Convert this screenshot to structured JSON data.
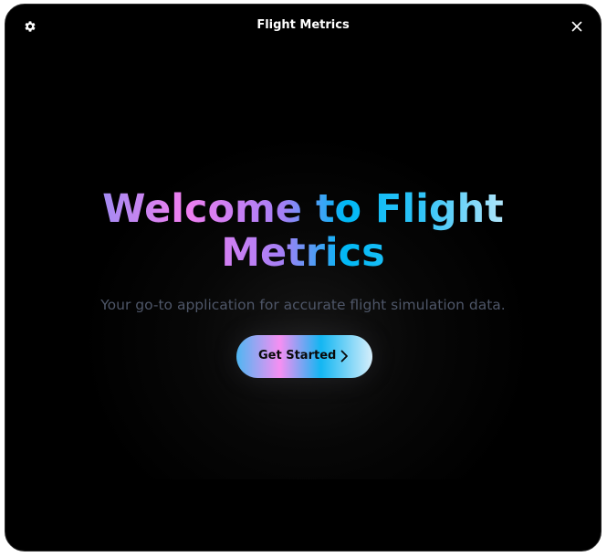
{
  "window": {
    "title": "Flight Metrics"
  },
  "icons": {
    "settings": "gear-icon",
    "close": "close-icon",
    "cta_arrow": "chevron-right-icon"
  },
  "hero": {
    "headline": "Welcome to Flight Metrics",
    "subtitle": "Your go-to application for accurate flight simulation data.",
    "cta_label": "Get Started"
  },
  "colors": {
    "background": "#000000",
    "title_text": "#ffffff",
    "subtitle_text": "#4e5668",
    "gradient_pink": "#f07ff0",
    "gradient_purple": "#9b8cf2",
    "gradient_blue": "#00b8f5",
    "gradient_light": "#bfe9fb"
  }
}
